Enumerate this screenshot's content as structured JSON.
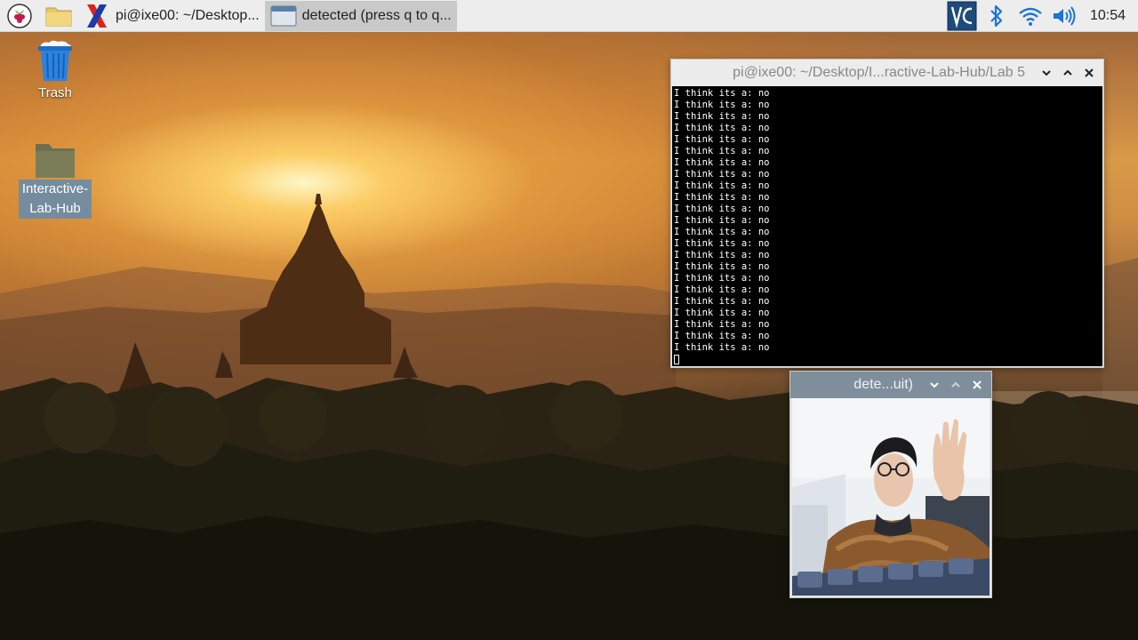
{
  "taskbar": {
    "tasks": [
      {
        "label": "pi@ixe00: ~/Desktop...",
        "icon": "terminal-x-icon",
        "active": false
      },
      {
        "label": "detected (press q to q...",
        "icon": "window-icon",
        "active": true
      }
    ],
    "clock": "10:54"
  },
  "desktop": {
    "icons": [
      {
        "label": "Trash",
        "icon": "trash-icon"
      },
      {
        "label": "Interactive-Lab-Hub",
        "icon": "folder-icon"
      }
    ]
  },
  "terminal": {
    "title": "pi@ixe00: ~/Desktop/I...ractive-Lab-Hub/Lab 5",
    "lines": [
      "I think its a: no",
      "I think its a: no",
      "I think its a: no",
      "I think its a: no",
      "I think its a: no",
      "I think its a: no",
      "I think its a: no",
      "I think its a: no",
      "I think its a: no",
      "I think its a: no",
      "I think its a: no",
      "I think its a: no",
      "I think its a: no",
      "I think its a: no",
      "I think its a: no",
      "I think its a: no",
      "I think its a: no",
      "I think its a: no",
      "I think its a: no",
      "I think its a: no",
      "I think its a: no",
      "I think its a: no",
      "I think its a: no"
    ]
  },
  "camera_window": {
    "title": "dete...uit)"
  },
  "colors": {
    "taskbar_bg": "#ededed",
    "vnc_blue": "#1e4a7c",
    "bluetooth_blue": "#1b74d6",
    "inactive_titlebar": "#7e8f9b"
  }
}
